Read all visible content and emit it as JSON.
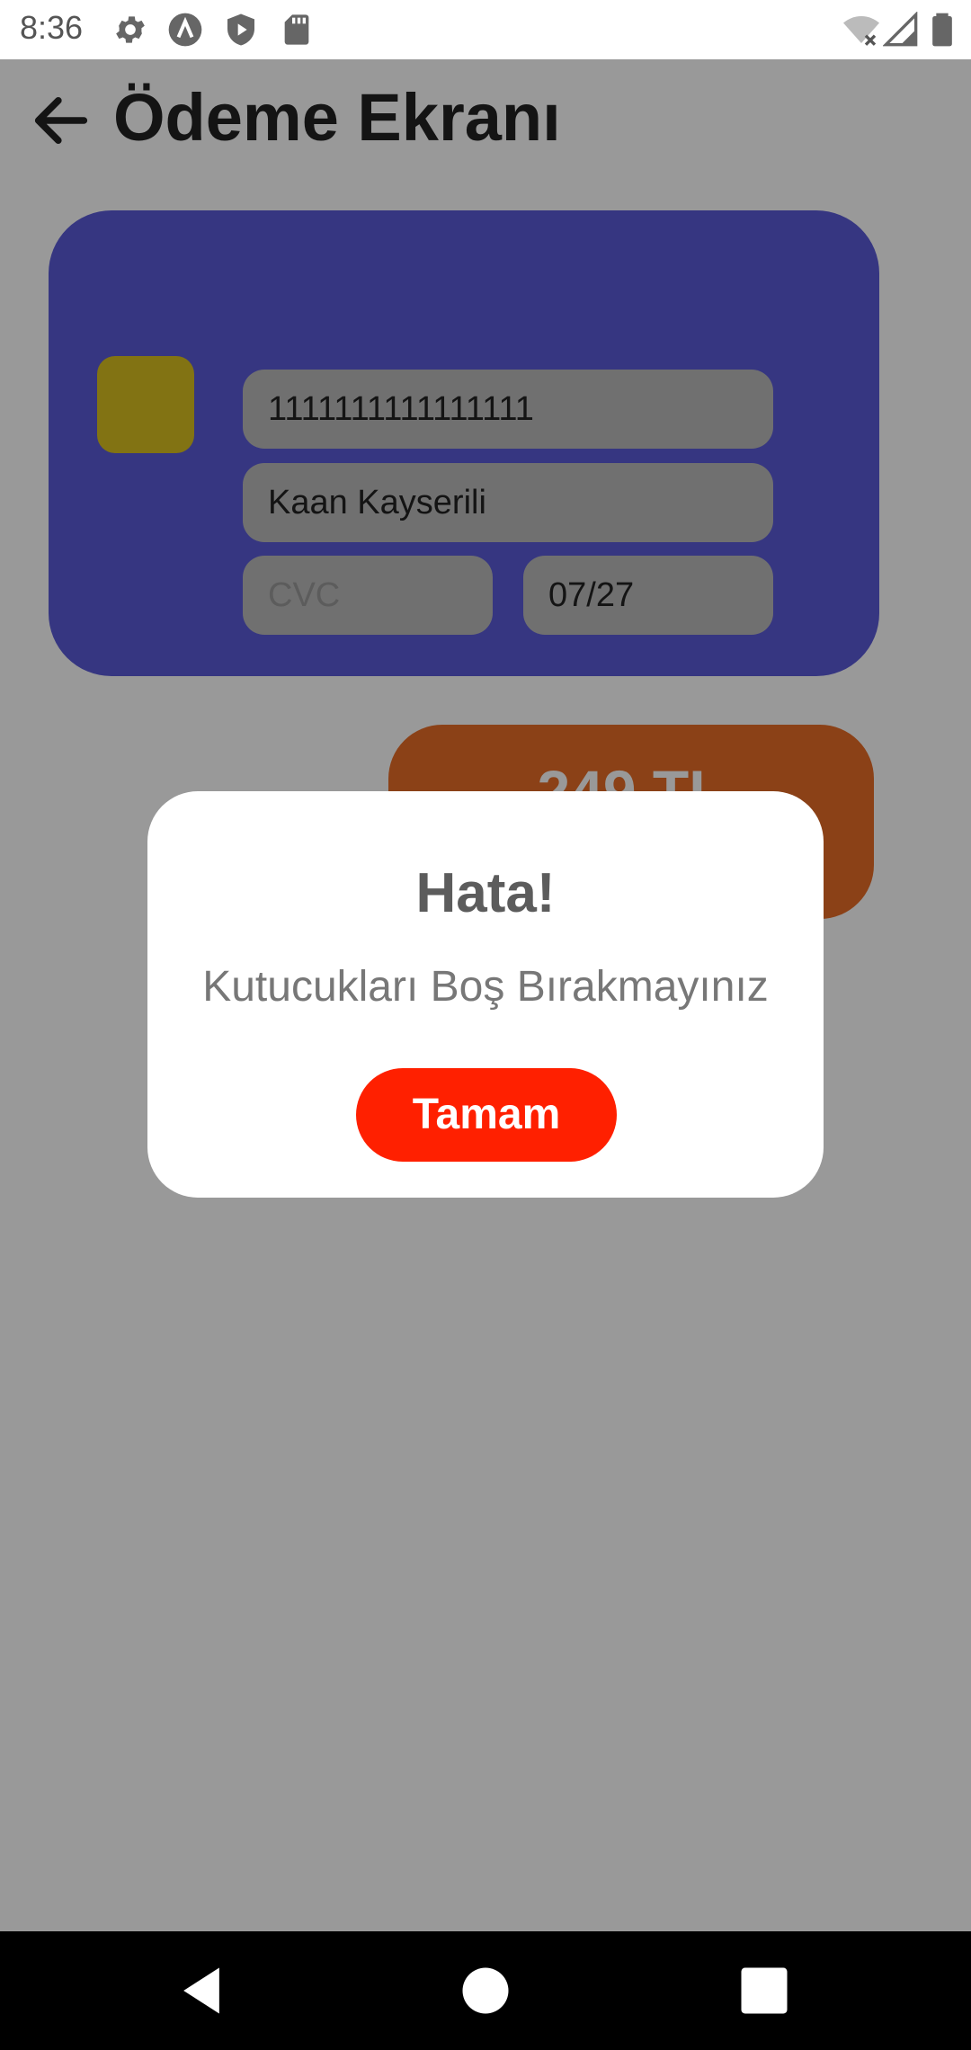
{
  "status_bar": {
    "time": "8:36",
    "icons": [
      "gear-icon",
      "app-a-icon",
      "shield-play-icon",
      "sd-card-icon",
      "wifi-off-icon",
      "signal-icon",
      "battery-icon"
    ]
  },
  "header": {
    "back_icon": "arrow-left-icon",
    "title": "Ödeme Ekranı"
  },
  "card": {
    "number_value": "1111111111111111",
    "name_value": "Kaan Kayserili",
    "cvc_placeholder": "CVC",
    "cvc_value": "",
    "expiry_value": "07/27",
    "colors": {
      "card": "#5a5ad7",
      "chip": "#d9c020",
      "field": "#bbbbbb"
    }
  },
  "price_button": {
    "label": "249 TL",
    "color": "#e86d27"
  },
  "dialog": {
    "title": "Hata!",
    "message": "Kutucukları Boş Bırakmayınız",
    "ok_label": "Tamam",
    "ok_color": "#ff2000"
  },
  "nav_bar": {
    "back_icon": "nav-back-icon",
    "home_icon": "nav-home-icon",
    "recents_icon": "nav-recents-icon"
  }
}
